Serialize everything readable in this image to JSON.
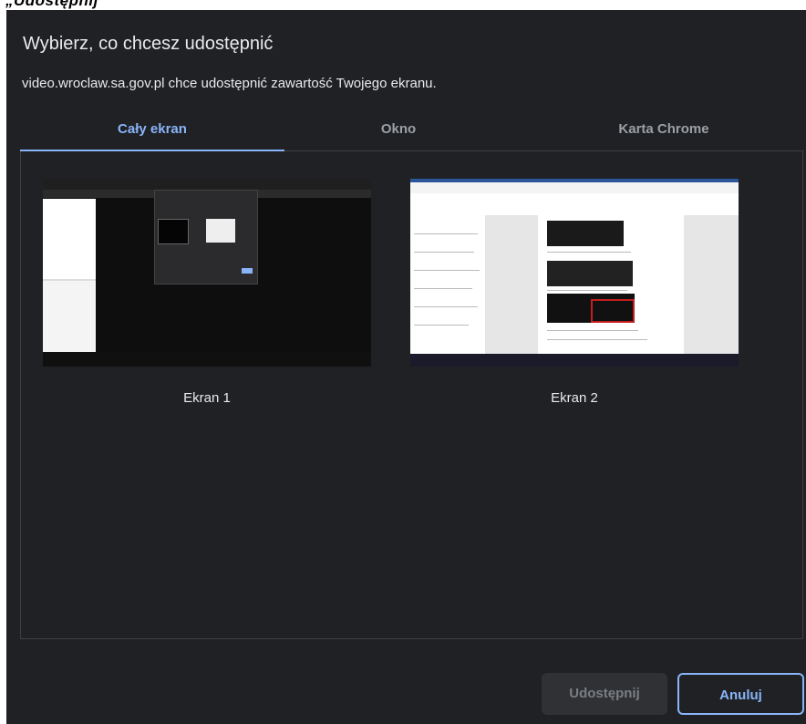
{
  "dialog": {
    "title": "Wybierz, co chcesz udostępnić",
    "subtitle": "video.wroclaw.sa.gov.pl chce udostępnić zawartość Twojego ekranu."
  },
  "tabs": [
    {
      "label": "Cały ekran",
      "active": true
    },
    {
      "label": "Okno",
      "active": false
    },
    {
      "label": "Karta Chrome",
      "active": false
    }
  ],
  "sources": [
    {
      "label": "Ekran 1"
    },
    {
      "label": "Ekran 2"
    }
  ],
  "buttons": {
    "share_label": "Udostępnij",
    "cancel_label": "Anuluj",
    "share_enabled": false
  },
  "colors": {
    "background": "#202124",
    "accent": "#8ab4f8",
    "text": "#e8eaed",
    "muted": "#9aa0a6"
  }
}
